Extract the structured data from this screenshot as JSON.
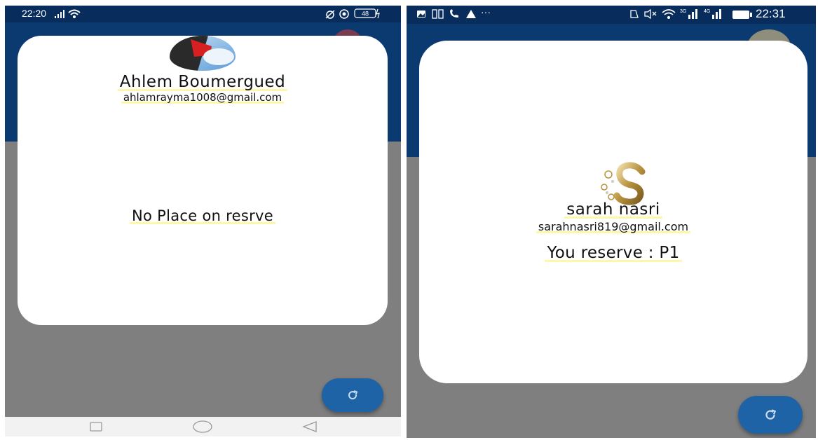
{
  "left_screen": {
    "status": {
      "time": "22:20",
      "battery": "48"
    },
    "profile": {
      "name": "Ahlem Boumergued",
      "email": "ahlamrayma1008@gmail.com",
      "message": "No Place on resrve"
    },
    "refresh_icon": "refresh-icon"
  },
  "right_screen": {
    "status": {
      "time": "22:31",
      "net_3g": "3G",
      "net_4g": "4G"
    },
    "profile": {
      "name": "sarah nasri",
      "email": "sarahnasri819@gmail.com",
      "message": "You reserve : P1"
    },
    "refresh_icon": "refresh-icon"
  },
  "colors": {
    "header_blue": "#0b3a70",
    "status_blue": "#082c5c",
    "overlay_gray": "#7f7f7f",
    "fab_blue": "#1e63a6",
    "highlight": "#fff7a8"
  }
}
